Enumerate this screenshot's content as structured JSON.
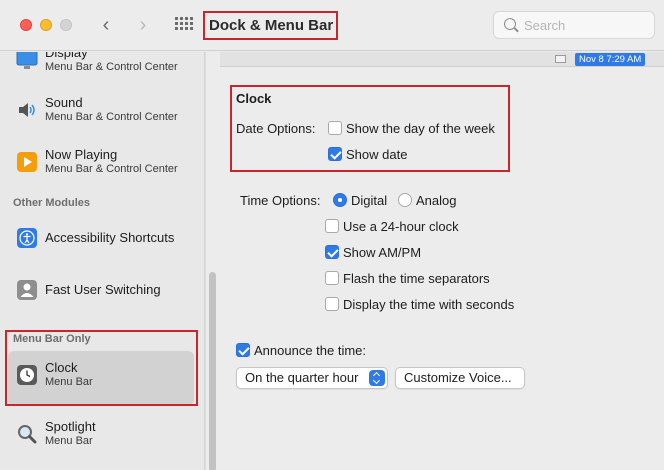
{
  "window": {
    "title": "Dock & Menu Bar"
  },
  "search": {
    "placeholder": "Search"
  },
  "sidebar": {
    "items_top": [
      {
        "name": "Display",
        "sub": "Menu Bar & Control Center",
        "icon": "display-icon"
      },
      {
        "name": "Sound",
        "sub": "Menu Bar & Control Center",
        "icon": "speaker-icon"
      },
      {
        "name": "Now Playing",
        "sub": "Menu Bar & Control Center",
        "icon": "play-icon"
      }
    ],
    "section_other": "Other Modules",
    "other_items": [
      {
        "name": "Accessibility Shortcuts",
        "icon": "accessibility-icon"
      },
      {
        "name": "Fast User Switching",
        "icon": "user-icon"
      }
    ],
    "section_menubar": "Menu Bar Only",
    "menubar_items": [
      {
        "name": "Clock",
        "sub": "Menu Bar",
        "icon": "clock-icon",
        "selected": true
      },
      {
        "name": "Spotlight",
        "sub": "Menu Bar",
        "icon": "magnifier-icon"
      }
    ]
  },
  "menubar_preview": {
    "date_time": "Nov 8  7:29 AM"
  },
  "clock": {
    "heading": "Clock",
    "date_options_label": "Date Options:",
    "show_day_of_week": {
      "label": "Show the day of the week",
      "checked": false
    },
    "show_date": {
      "label": "Show date",
      "checked": true
    },
    "time_options_label": "Time Options:",
    "digital": {
      "label": "Digital",
      "selected": true
    },
    "analog": {
      "label": "Analog",
      "selected": false
    },
    "use_24_hour": {
      "label": "Use a 24-hour clock",
      "checked": false
    },
    "show_am_pm": {
      "label": "Show AM/PM",
      "checked": true
    },
    "flash_separators": {
      "label": "Flash the time separators",
      "checked": false
    },
    "display_seconds": {
      "label": "Display the time with seconds",
      "checked": false
    },
    "announce": {
      "label": "Announce the time:",
      "checked": true
    },
    "announce_interval": "On the quarter hour",
    "customize_voice": "Customize Voice..."
  },
  "colors": {
    "accent": "#2f7ae5",
    "highlight_box": "#c9252c"
  }
}
